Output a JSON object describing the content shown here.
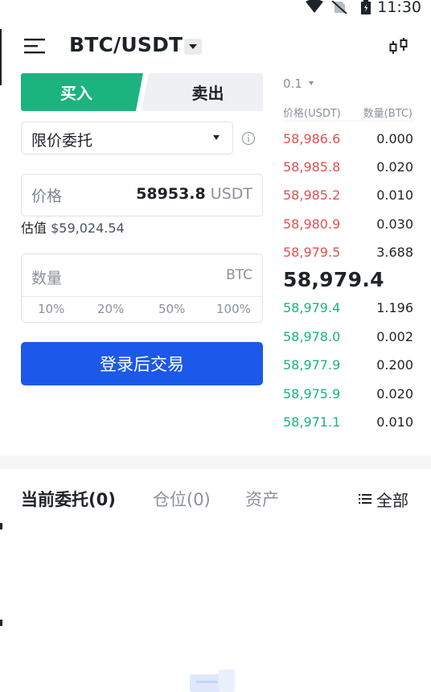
{
  "status_bar": {
    "time": "11:30"
  },
  "header": {
    "pair": "BTC/USDT"
  },
  "trade_tabs": {
    "buy": "买入",
    "sell": "卖出"
  },
  "order_form": {
    "order_type": "限价委托",
    "price_label": "价格",
    "price_value": "58953.8",
    "price_unit": "USDT",
    "estimate_label": "估值",
    "estimate_value": "$59,024.54",
    "qty_placeholder": "数量",
    "qty_unit": "BTC",
    "percent_options": [
      "10%",
      "20%",
      "50%",
      "100%"
    ],
    "submit_label": "登录后交易"
  },
  "order_book": {
    "precision": "0.1",
    "price_header": "价格(USDT)",
    "qty_header": "数量(BTC)",
    "asks": [
      {
        "price": "58,986.6",
        "qty": "0.000"
      },
      {
        "price": "58,985.8",
        "qty": "0.020"
      },
      {
        "price": "58,985.2",
        "qty": "0.010"
      },
      {
        "price": "58,980.9",
        "qty": "0.030"
      },
      {
        "price": "58,979.5",
        "qty": "3.688"
      }
    ],
    "last_price": "58,979.4",
    "bids": [
      {
        "price": "58,979.4",
        "qty": "1.196"
      },
      {
        "price": "58,978.0",
        "qty": "0.002"
      },
      {
        "price": "58,977.9",
        "qty": "0.200"
      },
      {
        "price": "58,975.9",
        "qty": "0.020"
      },
      {
        "price": "58,971.1",
        "qty": "0.010"
      }
    ]
  },
  "bottom_tabs": {
    "open_orders": "当前委托(0)",
    "positions": "仓位(0)",
    "assets": "资产",
    "filter_all": "全部"
  },
  "colors": {
    "buy_green": "#1bb37e",
    "sell_red": "#e2504f",
    "primary_blue": "#1c58ea"
  },
  "icons": [
    "wifi-icon",
    "no-sim-icon",
    "battery-icon",
    "menu-icon",
    "dropdown-caret-icon",
    "candlestick-chart-icon",
    "info-icon",
    "list-icon"
  ]
}
